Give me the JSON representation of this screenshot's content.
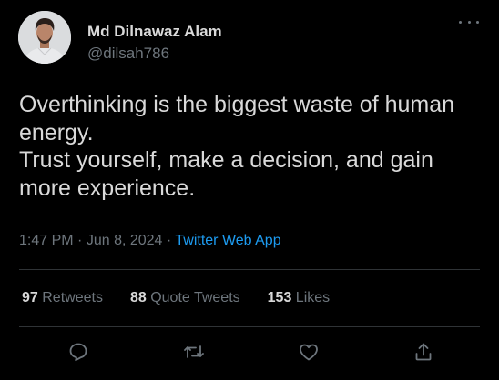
{
  "user": {
    "display_name": "Md Dilnawaz Alam",
    "handle": "@dilsah786"
  },
  "tweet": {
    "lines": [
      "Overthinking is the biggest waste of human energy.",
      "Trust yourself, make a decision, and gain more experience."
    ],
    "time": "1:47 PM",
    "date": "Jun 8, 2024",
    "separator": "·",
    "source_app": "Twitter Web App"
  },
  "stats": {
    "retweets_count": "97",
    "retweets_label": "Retweets",
    "quote_tweets_count": "88",
    "quote_tweets_label": "Quote Tweets",
    "likes_count": "153",
    "likes_label": "Likes"
  },
  "actions": [
    "reply-icon",
    "retweet-icon",
    "like-icon",
    "share-icon"
  ],
  "colors": {
    "background": "#000000",
    "text_primary": "#d9d9d9",
    "text_secondary": "#6e767d",
    "link": "#1d9bf0",
    "divider": "#2f3336"
  }
}
